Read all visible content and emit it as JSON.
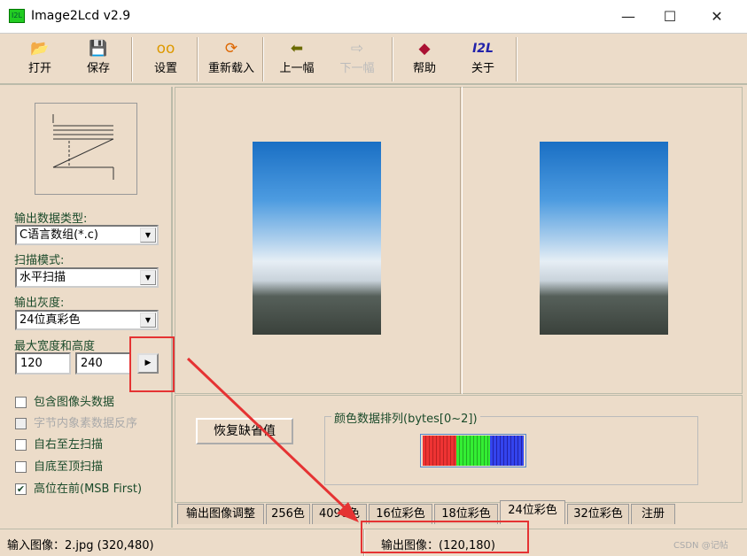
{
  "window": {
    "title": "Image2Lcd v2.9",
    "icon_text": "I2L",
    "minimize": "—",
    "maximize": "☐",
    "close": "✕"
  },
  "toolbar": [
    {
      "label": "打开",
      "icon": "open-folder-icon"
    },
    {
      "label": "保存",
      "icon": "floppy-icon"
    },
    {
      "label": "设置",
      "icon": "glasses-icon"
    },
    {
      "label": "重新载入",
      "icon": "reload-icon"
    },
    {
      "label": "上一幅",
      "icon": "arrow-left-icon"
    },
    {
      "label": "下一幅",
      "icon": "arrow-right-icon",
      "disabled": true
    },
    {
      "label": "帮助",
      "icon": "help-book-icon"
    },
    {
      "label": "关于",
      "icon": "i2l-logo-icon",
      "text": "I2L"
    }
  ],
  "left": {
    "output_type_label": "输出数据类型:",
    "output_type": "C语言数组(*.c)",
    "scan_mode_label": "扫描模式:",
    "scan_mode": "水平扫描",
    "gray_label": "输出灰度:",
    "gray": "24位真彩色",
    "size_label": "最大宽度和高度",
    "width": "120",
    "height": "240",
    "apply": "▶",
    "checkboxes": [
      {
        "label": "包含图像头数据",
        "checked": false
      },
      {
        "label": "字节内象素数据反序",
        "checked": false,
        "disabled": true
      },
      {
        "label": "自右至左扫描",
        "checked": false
      },
      {
        "label": "自底至顶扫描",
        "checked": false
      },
      {
        "label": "高位在前(MSB First)",
        "checked": true
      }
    ]
  },
  "bottom": {
    "reset": "恢复缺省值",
    "group_label": "颜色数据排列(bytes[0~2])",
    "colors": [
      "#ee3333",
      "#33ee33",
      "#3344ee"
    ]
  },
  "tabs": [
    "输出图像调整",
    "256色",
    "4096色",
    "16位彩色",
    "18位彩色",
    "24位彩色",
    "32位彩色",
    "注册"
  ],
  "active_tab": 5,
  "status": {
    "input": "输入图像：2.jpg (320,480)",
    "output": "输出图像：(120,180)",
    "watermark": "CSDN @记帖"
  }
}
